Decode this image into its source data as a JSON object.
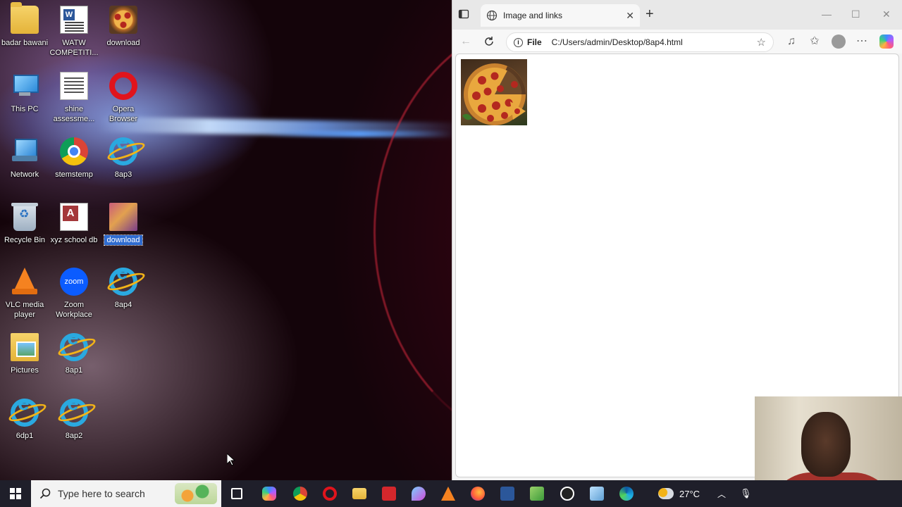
{
  "desktop": {
    "icons": [
      {
        "label": "badar bawani"
      },
      {
        "label": "WATW COMPETITI..."
      },
      {
        "label": "download"
      },
      {
        "label": "This PC"
      },
      {
        "label": "shine assessme..."
      },
      {
        "label": "Opera Browser"
      },
      {
        "label": "Network"
      },
      {
        "label": "stemstemp"
      },
      {
        "label": "8ap3"
      },
      {
        "label": "Recycle Bin"
      },
      {
        "label": "xyz school db"
      },
      {
        "label": "download"
      },
      {
        "label": "VLC media player"
      },
      {
        "label": "Zoom Workplace"
      },
      {
        "label": "8ap4"
      },
      {
        "label": "Pictures"
      },
      {
        "label": "8ap1"
      },
      {
        "label": "6dp1"
      },
      {
        "label": "8ap2"
      }
    ]
  },
  "browser": {
    "tab_title": "Image and links",
    "address_scheme": "File",
    "address_url": "C:/Users/admin/Desktop/8ap4.html"
  },
  "taskbar": {
    "search_placeholder": "Type here to search",
    "temperature": "27°C"
  },
  "colors": {
    "taskbar_bg": "#1f1f2a",
    "selection": "#2f6cd0"
  }
}
